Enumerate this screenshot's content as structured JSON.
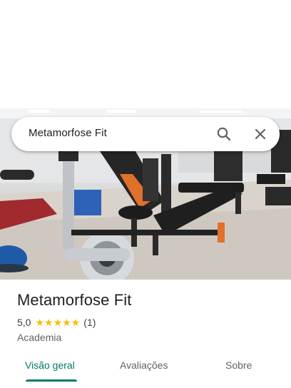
{
  "search": {
    "query": "Metamorfose Fit",
    "search_icon": "search-icon",
    "close_icon": "close-icon"
  },
  "place": {
    "name": "Metamorfose Fit",
    "rating": "5,0",
    "stars": 5,
    "review_count": "(1)",
    "category": "Academia"
  },
  "tabs": [
    {
      "label": "Visão geral",
      "active": true
    },
    {
      "label": "Avaliações",
      "active": false
    },
    {
      "label": "Sobre",
      "active": false
    }
  ],
  "colors": {
    "accent": "#00796b",
    "star": "#fbbc04",
    "text": "#202124",
    "secondary_text": "#5f6368"
  }
}
